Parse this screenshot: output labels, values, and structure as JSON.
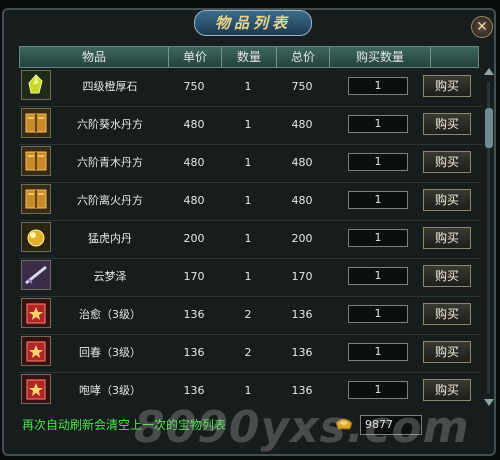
{
  "window": {
    "title": "物品列表",
    "close_label": "✕"
  },
  "table": {
    "headers": [
      "物品",
      "单价",
      "数量",
      "总价",
      "购买数量"
    ]
  },
  "items": [
    {
      "name": "四级橙厚石",
      "price": "750",
      "qty": "1",
      "total": "750",
      "buy_qty": "1",
      "buy_label": "购买",
      "icon": "yellow-crystal-icon"
    },
    {
      "name": "六阶葵水丹方",
      "price": "480",
      "qty": "1",
      "total": "480",
      "buy_qty": "1",
      "buy_label": "购买",
      "icon": "recipe-book-icon"
    },
    {
      "name": "六阶青木丹方",
      "price": "480",
      "qty": "1",
      "total": "480",
      "buy_qty": "1",
      "buy_label": "购买",
      "icon": "recipe-book-icon"
    },
    {
      "name": "六阶离火丹方",
      "price": "480",
      "qty": "1",
      "total": "480",
      "buy_qty": "1",
      "buy_label": "购买",
      "icon": "recipe-book-icon"
    },
    {
      "name": "猛虎内丹",
      "price": "200",
      "qty": "1",
      "total": "200",
      "buy_qty": "1",
      "buy_label": "购买",
      "icon": "golden-orb-icon"
    },
    {
      "name": "云梦泽",
      "price": "170",
      "qty": "1",
      "total": "170",
      "buy_qty": "1",
      "buy_label": "购买",
      "icon": "weapon-icon"
    },
    {
      "name": "治愈（3级）",
      "price": "136",
      "qty": "2",
      "total": "136",
      "buy_qty": "1",
      "buy_label": "购买",
      "icon": "skill-book-icon"
    },
    {
      "name": "回春（3级）",
      "price": "136",
      "qty": "2",
      "total": "136",
      "buy_qty": "1",
      "buy_label": "购买",
      "icon": "skill-book-icon"
    },
    {
      "name": "咆哮（3级）",
      "price": "136",
      "qty": "1",
      "total": "136",
      "buy_qty": "1",
      "buy_label": "购买",
      "icon": "skill-book-icon"
    }
  ],
  "footer": {
    "note": "再次自动刷新会清空上一次的宝物列表",
    "balance": "9877",
    "currency_icon": "gold-ingot-icon"
  },
  "watermark": "8090yxs.com",
  "colors": {
    "header_bg": "#3f6660",
    "note_green": "#49e34a",
    "title_gold": "#e9d48a"
  }
}
